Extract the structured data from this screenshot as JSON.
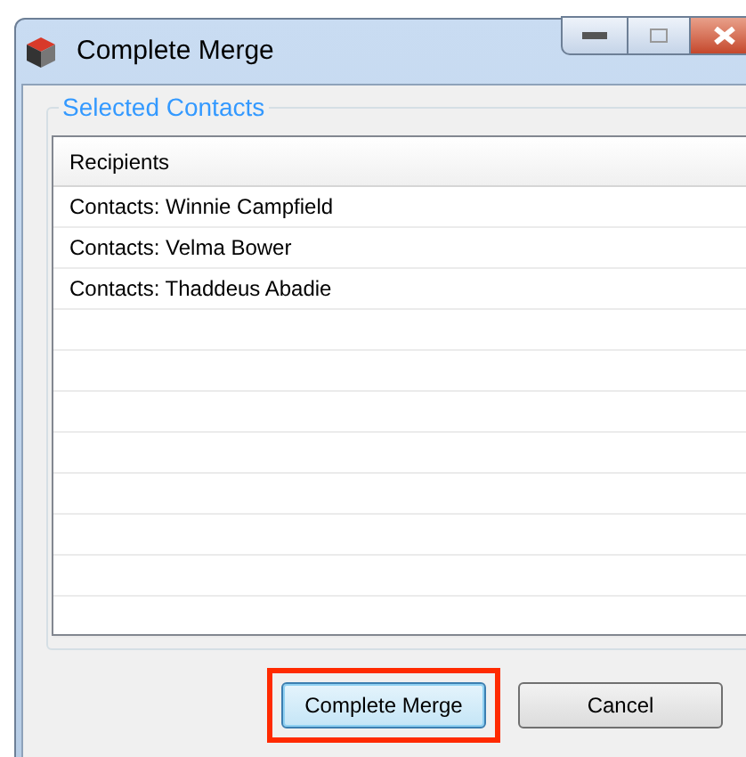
{
  "window": {
    "title": "Complete Merge"
  },
  "group": {
    "title": "Selected Contacts"
  },
  "table": {
    "columns": [
      "Recipients"
    ],
    "rows": [
      [
        "Contacts: Winnie Campfield"
      ],
      [
        "Contacts: Velma Bower"
      ],
      [
        "Contacts: Thaddeus Abadie"
      ]
    ]
  },
  "buttons": [
    {
      "label": "Complete Merge",
      "default": true,
      "highlighted": true
    },
    {
      "label": "Cancel",
      "default": false,
      "highlighted": false
    }
  ]
}
